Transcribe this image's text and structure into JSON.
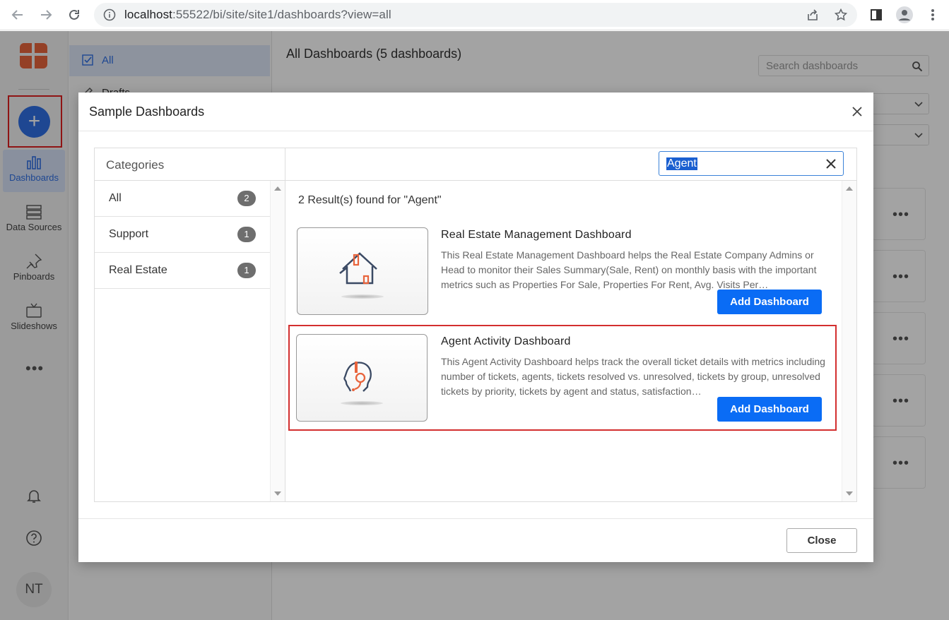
{
  "browser": {
    "url_host": "localhost",
    "url_rest": ":55522/bi/site/site1/dashboards?view=all"
  },
  "leftnav": {
    "items": [
      {
        "label": "Dashboards",
        "icon": "bar-chart-icon"
      },
      {
        "label": "Data Sources",
        "icon": "database-icon"
      },
      {
        "label": "Pinboards",
        "icon": "pin-icon"
      },
      {
        "label": "Slideshows",
        "icon": "tv-icon"
      }
    ],
    "more": "•••",
    "avatar": "NT"
  },
  "subnav": {
    "items": [
      {
        "label": "All"
      },
      {
        "label": "Drafts"
      }
    ]
  },
  "main": {
    "title": "All Dashboards (5 dashboards)",
    "search_placeholder": "Search dashboards",
    "card_more": "•••"
  },
  "dialog": {
    "title": "Sample Dashboards",
    "categories_title": "Categories",
    "categories": [
      {
        "label": "All",
        "count": "2"
      },
      {
        "label": "Support",
        "count": "1"
      },
      {
        "label": "Real Estate",
        "count": "1"
      }
    ],
    "search_value": "Agent",
    "result_count": "2 Result(s) found for \"Agent\"",
    "results": [
      {
        "title": "Real Estate Management Dashboard",
        "description": "This Real Estate Management Dashboard helps the Real Estate Company Admins or Head to monitor their Sales Summary(Sale, Rent) on monthly basis with the important metrics such as Properties For Sale, Properties For Rent, Avg. Visits Per…",
        "button": "Add Dashboard",
        "icon": "house-icon"
      },
      {
        "title": "Agent Activity Dashboard",
        "description": "This Agent Activity Dashboard helps track the overall ticket details with metrics including number of tickets, agents, tickets resolved vs. unresolved, tickets by group, unresolved tickets by priority, tickets by agent and status, satisfaction…",
        "button": "Add Dashboard",
        "icon": "agent-headset-icon"
      }
    ],
    "close_label": "Close"
  },
  "colors": {
    "accent": "#0a6cf5",
    "highlight": "#d32f2f",
    "brand": "#e8643c"
  }
}
